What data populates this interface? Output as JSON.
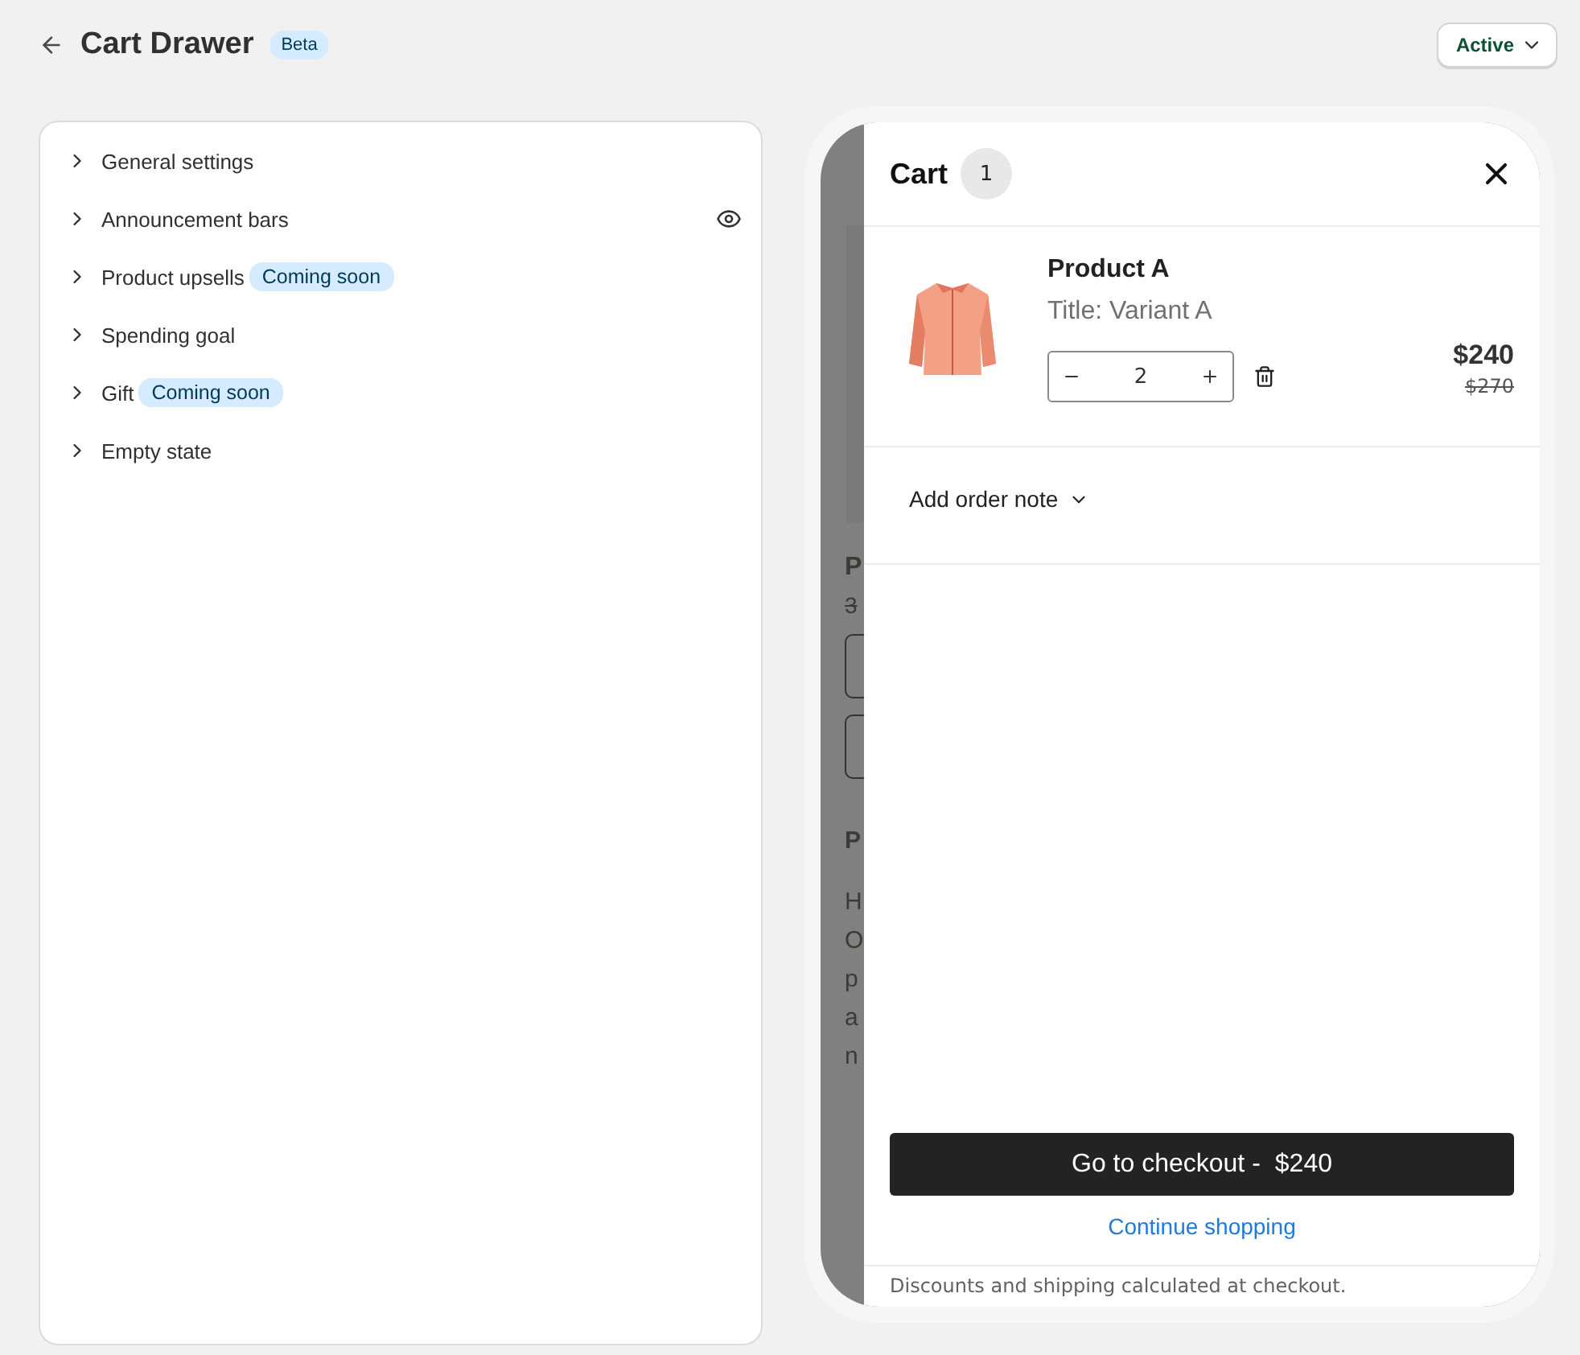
{
  "header": {
    "title": "Cart Drawer",
    "badge": "Beta",
    "status_button": "Active"
  },
  "settings": [
    {
      "label": "General settings",
      "expanded": false,
      "visibility_icon": false
    },
    {
      "label": "Announcement bars",
      "expanded": false,
      "visibility_icon": true
    },
    {
      "label": "Product upsells",
      "expanded": false,
      "visibility_icon": false,
      "badge": "Coming soon"
    },
    {
      "label": "Spending goal",
      "expanded": false,
      "visibility_icon": false
    },
    {
      "label": "Gift",
      "expanded": false,
      "visibility_icon": false,
      "badge": "Coming soon"
    },
    {
      "label": "Empty state",
      "expanded": false,
      "visibility_icon": false
    }
  ],
  "background_page": {
    "heading": "P",
    "price": "3",
    "subheading": "P",
    "lines": [
      "H",
      "O",
      "p",
      "a",
      "n"
    ]
  },
  "cart": {
    "title": "Cart",
    "count": "1",
    "items": [
      {
        "name": "Product A",
        "variant": "Title: Variant A",
        "quantity": "2",
        "price": "$240",
        "compare_price": "$270"
      }
    ],
    "order_note": "Add order note",
    "checkout_label": "Go to checkout -",
    "checkout_total": "$240",
    "continue": "Continue shopping",
    "footer_note": "Discounts and shipping calculated at checkout."
  }
}
